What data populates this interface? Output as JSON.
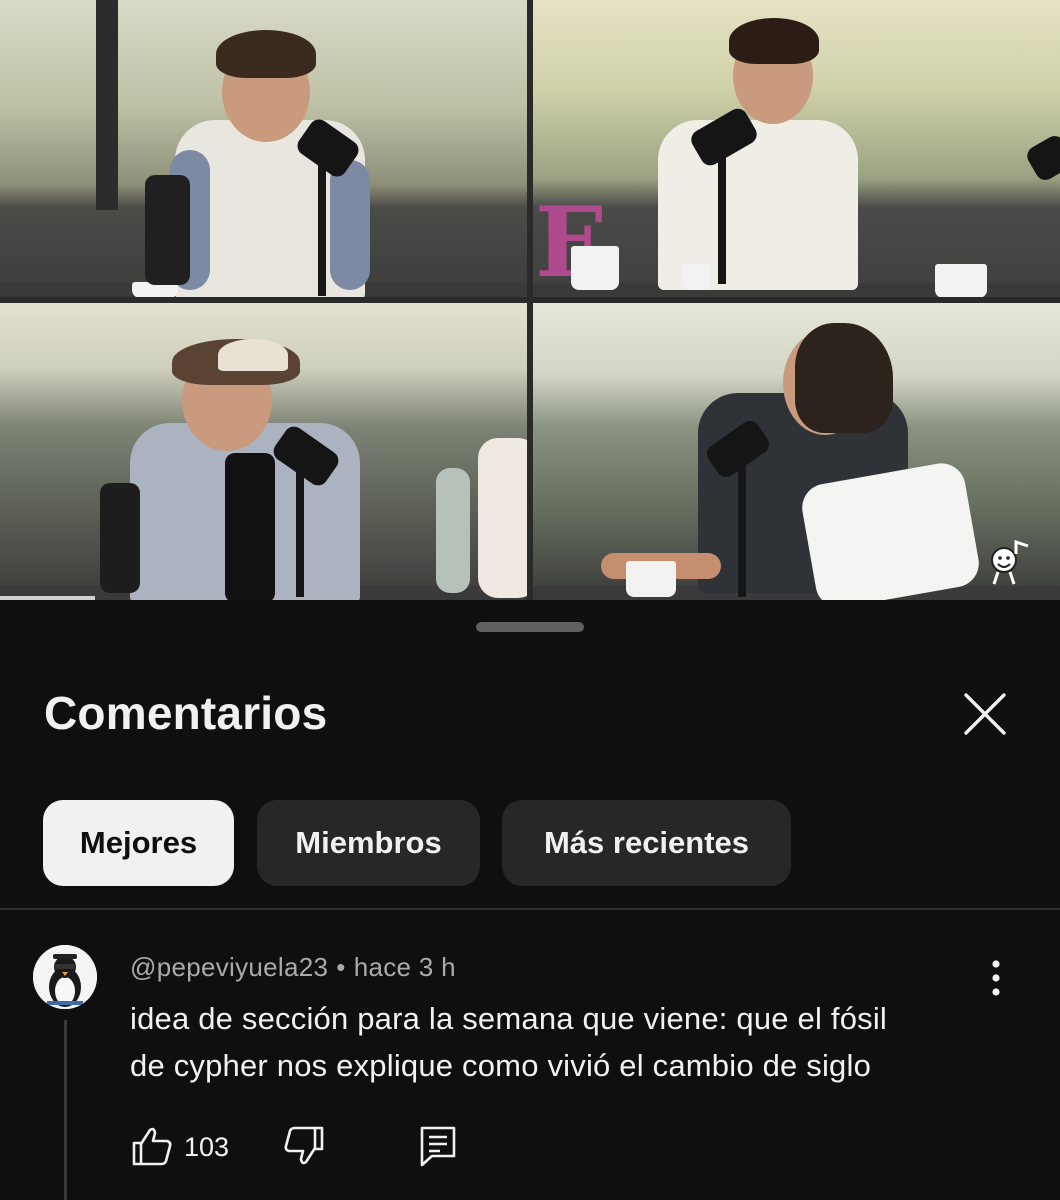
{
  "video": {
    "progress_fraction": 0.09,
    "scene": "four-panel podcast recording"
  },
  "comments_sheet": {
    "title": "Comentarios",
    "close_icon": "close-icon",
    "filters": [
      {
        "label": "Mejores",
        "selected": true
      },
      {
        "label": "Miembros",
        "selected": false
      },
      {
        "label": "Más recientes",
        "selected": false
      }
    ]
  },
  "comment": {
    "author": "@pepeviyuela23",
    "separator": "•",
    "time": "hace 3 h",
    "text_line1": "idea de sección para la semana que viene: que el fósil",
    "text_line2": "de cypher nos explique como vivió el cambio de siglo",
    "likes": "103",
    "icons": [
      "thumb-up-icon",
      "thumb-down-icon",
      "reply-icon",
      "more-vert-icon"
    ]
  },
  "colors": {
    "background": "#0f0f0f",
    "chip_bg": "#272727",
    "chip_active_bg": "#f1f1f1",
    "text_primary": "#f1f1f1",
    "text_secondary": "#aaaaaa"
  }
}
